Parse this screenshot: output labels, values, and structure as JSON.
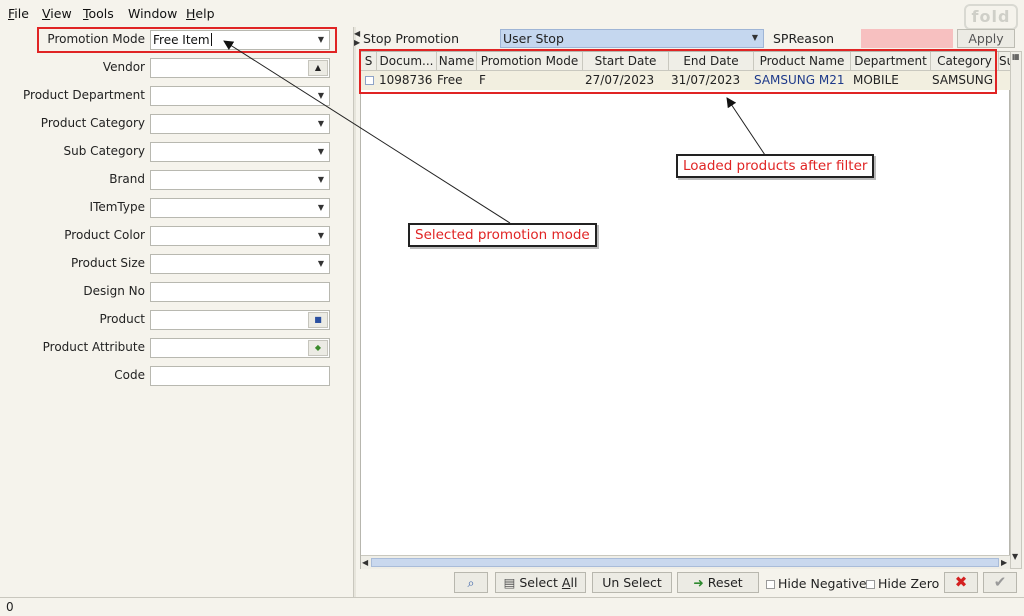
{
  "menu": {
    "file": {
      "u": "F",
      "rest": "ile"
    },
    "view": {
      "u": "V",
      "rest": "iew"
    },
    "tools": {
      "u": "T",
      "rest": "ools"
    },
    "window": {
      "u": "",
      "rest": "Window"
    },
    "help": {
      "u": "H",
      "rest": "elp"
    }
  },
  "filters": {
    "promotion_mode": {
      "label": "Promotion Mode",
      "value": "Free Item"
    },
    "vendor": {
      "label": "Vendor"
    },
    "product_department": {
      "label": "Product Department"
    },
    "product_category": {
      "label": "Product Category"
    },
    "sub_category": {
      "label": "Sub Category"
    },
    "brand": {
      "label": "Brand"
    },
    "item_type": {
      "label": "ITemType"
    },
    "product_color": {
      "label": "Product Color"
    },
    "product_size": {
      "label": "Product Size"
    },
    "design_no": {
      "label": "Design No"
    },
    "product": {
      "label": "Product"
    },
    "product_attribute": {
      "label": "Product Attribute"
    },
    "code": {
      "label": "Code"
    }
  },
  "stop_bar": {
    "stop_label": "Stop Promotion",
    "stop_value": "User Stop",
    "spreason_label": "SPReason",
    "apply_label": "Apply"
  },
  "grid": {
    "columns": [
      "S",
      "Docum...",
      "Name",
      "Promotion Mode",
      "Start Date",
      "End Date",
      "Product Name",
      "Department",
      "Category",
      "Su"
    ],
    "rows": [
      {
        "document": "1098736",
        "name": "Free",
        "promotion_mode": "F",
        "start_date": "27/07/2023",
        "end_date": "31/07/2023",
        "product_name": "SAMSUNG M21",
        "department": "MOBILE",
        "category": "SAMSUNG"
      }
    ]
  },
  "toolbar": {
    "select_all": {
      "u": "",
      "pre": "Select ",
      "uletter": "A",
      "post": "ll"
    },
    "un_select": "Un Select",
    "reset": "Reset",
    "hide_negative": "Hide Negative",
    "hide_zero": "Hide Zero"
  },
  "status": {
    "text": "0"
  },
  "annotations": {
    "selected_mode": "Selected promotion mode",
    "loaded_products": "Loaded products after filter"
  },
  "logo_text": "fold",
  "colors": {
    "annotation_red": "#e02424",
    "selection_blue": "#c5d7ef",
    "spreason_pink": "#f7c0c0"
  }
}
